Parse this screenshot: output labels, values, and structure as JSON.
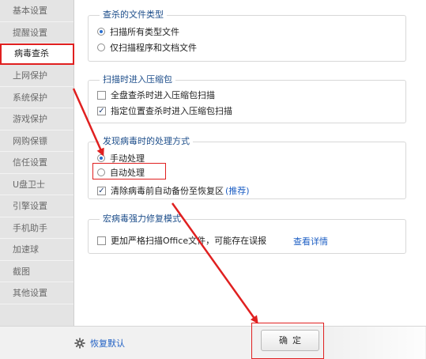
{
  "sidebar": {
    "items": [
      {
        "label": "基本设置",
        "active": false
      },
      {
        "label": "提醒设置",
        "active": false
      },
      {
        "label": "病毒查杀",
        "active": true
      },
      {
        "label": "上网保护",
        "active": false
      },
      {
        "label": "系统保护",
        "active": false
      },
      {
        "label": "游戏保护",
        "active": false
      },
      {
        "label": "网购保镖",
        "active": false
      },
      {
        "label": "信任设置",
        "active": false
      },
      {
        "label": "U盘卫士",
        "active": false
      },
      {
        "label": "引擎设置",
        "active": false
      },
      {
        "label": "手机助手",
        "active": false
      },
      {
        "label": "加速球",
        "active": false
      },
      {
        "label": "截图",
        "active": false
      },
      {
        "label": "其他设置",
        "active": false
      }
    ]
  },
  "groups": {
    "file_types": {
      "title": "查杀的文件类型",
      "scan_all": "扫描所有类型文件",
      "scan_programs": "仅扫描程序和文档文件"
    },
    "archive": {
      "title": "扫描时进入压缩包",
      "full_scan": "全盘查杀时进入压缩包扫描",
      "custom_scan": "指定位置查杀时进入压缩包扫描"
    },
    "on_virus": {
      "title": "发现病毒时的处理方式",
      "manual": "手动处理",
      "auto": "自动处理",
      "backup": "清除病毒前自动备份至恢复区",
      "recommended": "(推荐)"
    },
    "macro": {
      "title": "宏病毒强力修复模式",
      "strict": "更加严格扫描Office文件，可能存在误报",
      "details": "查看详情"
    }
  },
  "footer": {
    "restore_label": "恢复默认",
    "ok_label": "确定"
  },
  "colors": {
    "accent": "#e02020",
    "link": "#1e5fc4",
    "group_title": "#1c4d8a"
  }
}
